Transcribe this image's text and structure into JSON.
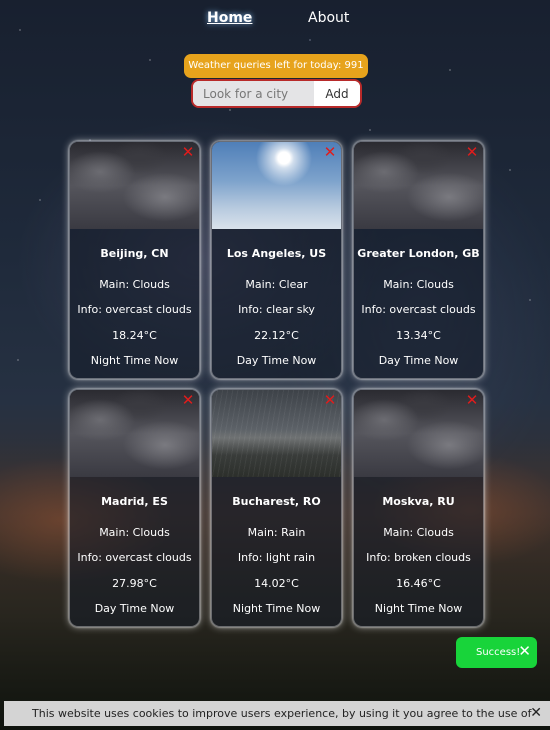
{
  "nav": {
    "home": "Home",
    "about": "About"
  },
  "quota": {
    "text": "Weather queries left for today: 991"
  },
  "search": {
    "placeholder": "Look for a city",
    "button": "Add"
  },
  "cards": [
    {
      "city": "Beijing, CN",
      "main": "Main: Clouds",
      "info": "Info: overcast clouds",
      "temp": "18.24°C",
      "time": "Night Time Now",
      "photo": "clouds"
    },
    {
      "city": "Los Angeles, US",
      "main": "Main: Clear",
      "info": "Info: clear sky",
      "temp": "22.12°C",
      "time": "Day Time Now",
      "photo": "clear"
    },
    {
      "city": "Greater London, GB",
      "main": "Main: Clouds",
      "info": "Info: overcast clouds",
      "temp": "13.34°C",
      "time": "Day Time Now",
      "photo": "clouds"
    },
    {
      "city": "Madrid, ES",
      "main": "Main: Clouds",
      "info": "Info: overcast clouds",
      "temp": "27.98°C",
      "time": "Day Time Now",
      "photo": "clouds"
    },
    {
      "city": "Bucharest, RO",
      "main": "Main: Rain",
      "info": "Info: light rain",
      "temp": "14.02°C",
      "time": "Night Time Now",
      "photo": "rain"
    },
    {
      "city": "Moskva, RU",
      "main": "Main: Clouds",
      "info": "Info: broken clouds",
      "temp": "16.46°C",
      "time": "Night Time Now",
      "photo": "clouds"
    }
  ],
  "close_icon": "✕",
  "toast": {
    "text": "Success!",
    "close": "✕"
  },
  "cookie": {
    "text": "This website uses cookies to improve users experience, by using it you agree to the use of cookies.",
    "close": "✕"
  },
  "colors": {
    "quota": "#e7a31c",
    "search_border": "#b82a2a",
    "close": "#e01c1c",
    "toast": "#18d43a",
    "cookie_bar": "#d4d4d4"
  }
}
